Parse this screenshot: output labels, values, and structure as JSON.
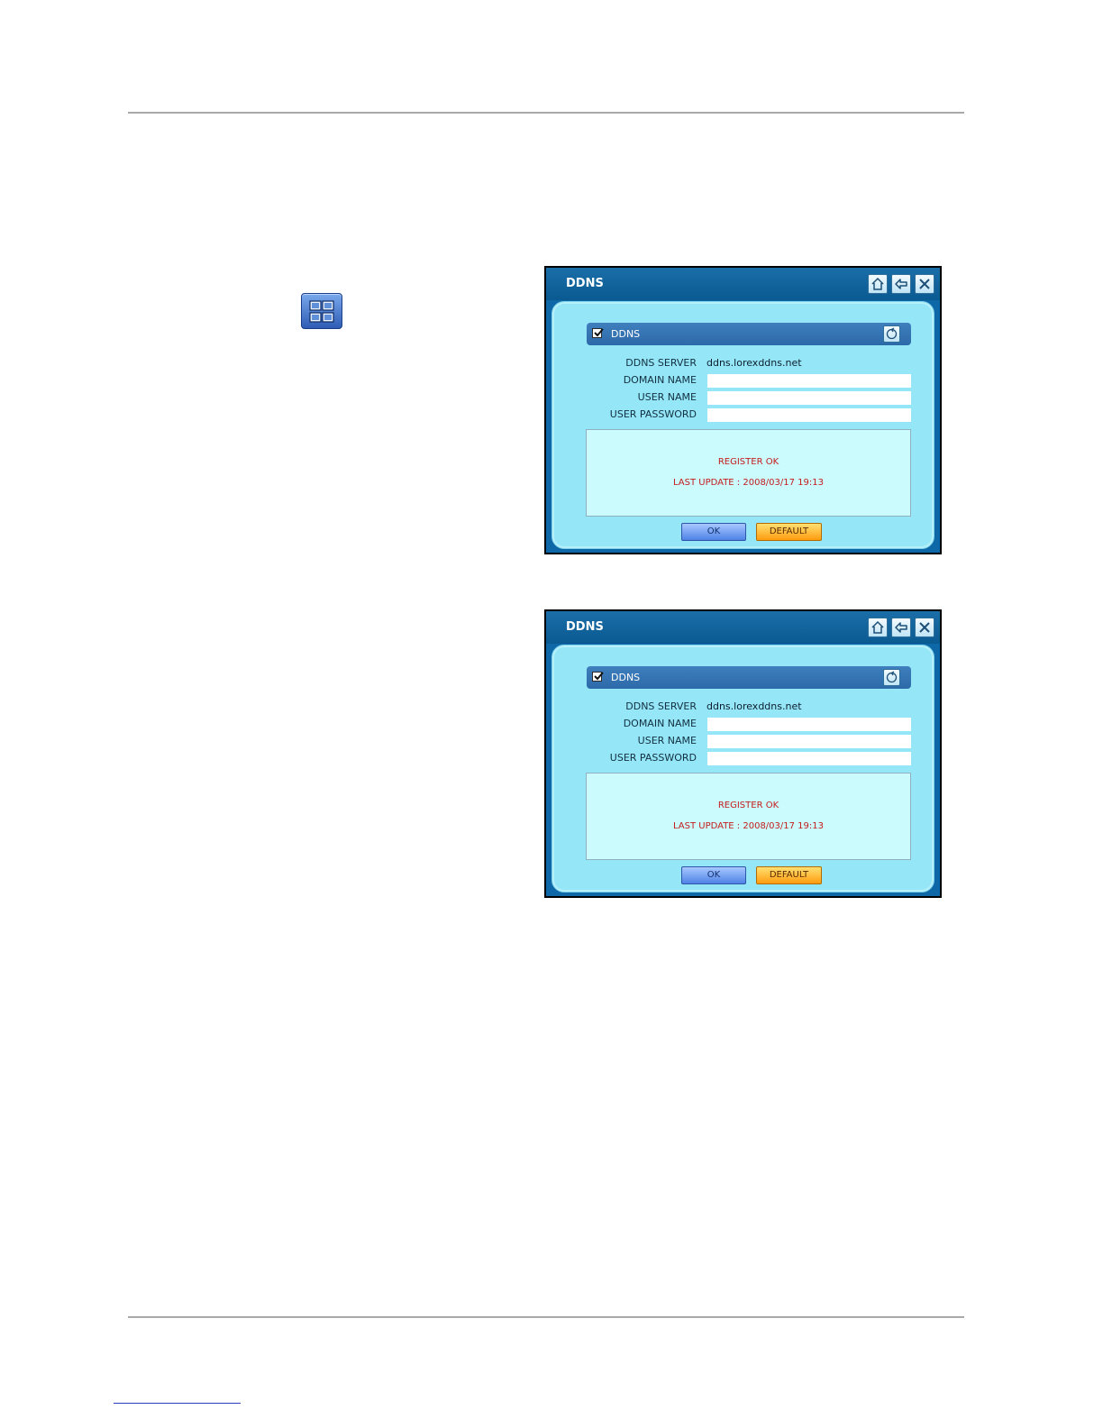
{
  "dialogs": [
    {
      "title": "DDNS",
      "section_label": "DDNS",
      "section_checked": true,
      "fields": {
        "ddns_server_label": "DDNS SERVER",
        "ddns_server_value": "ddns.lorexddns.net",
        "domain_name_label": "DOMAIN NAME",
        "domain_name_value": "",
        "user_name_label": "USER NAME",
        "user_name_value": "",
        "user_password_label": "USER PASSWORD",
        "user_password_value": ""
      },
      "status": {
        "line1": "REGISTER OK",
        "line2": "LAST UPDATE : 2008/03/17 19:13"
      },
      "buttons": {
        "ok": "OK",
        "default": "DEFAULT"
      }
    },
    {
      "title": "DDNS",
      "section_label": "DDNS",
      "section_checked": true,
      "fields": {
        "ddns_server_label": "DDNS SERVER",
        "ddns_server_value": "ddns.lorexddns.net",
        "domain_name_label": "DOMAIN NAME",
        "domain_name_value": "",
        "user_name_label": "USER NAME",
        "user_name_value": "",
        "user_password_label": "USER PASSWORD",
        "user_password_value": ""
      },
      "status": {
        "line1": "REGISTER OK",
        "line2": "LAST UPDATE : 2008/03/17 19:13"
      },
      "buttons": {
        "ok": "OK",
        "default": "DEFAULT"
      }
    }
  ],
  "icons": {
    "network_setup": "network-icon",
    "home": "home-icon",
    "back": "back-arrow-icon",
    "close": "close-icon",
    "refresh": "refresh-icon",
    "checkbox": "checkmark-icon"
  },
  "colors": {
    "titlebar": "#0e68a8",
    "panel": "#95e6f7",
    "section_header": "#3377b6",
    "status_text": "#c41c1c",
    "ok_button": "#4f82e6",
    "default_button": "#ff9c10"
  }
}
